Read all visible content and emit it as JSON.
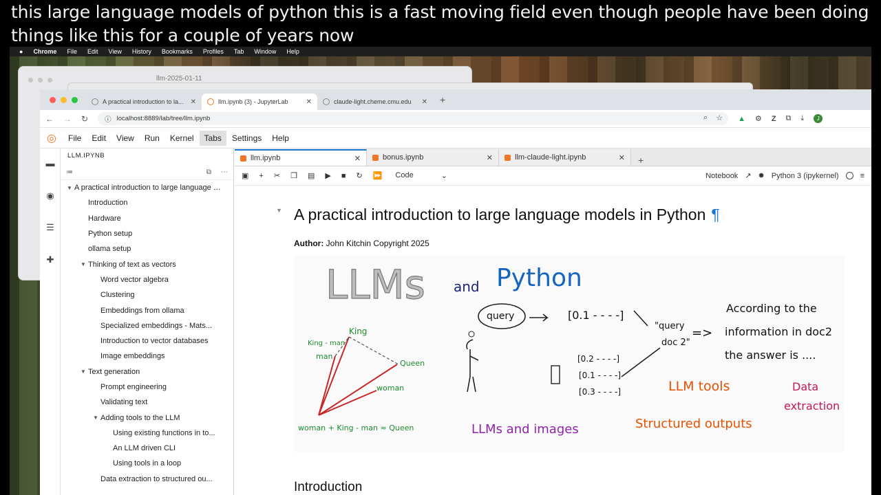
{
  "caption": {
    "line1": "this large language models of python this is a fast moving field even though people have been doing",
    "line2": "things like this for a couple of years now"
  },
  "macos_menu": {
    "apple": "",
    "items": [
      "Chrome",
      "File",
      "Edit",
      "View",
      "History",
      "Bookmarks",
      "Profiles",
      "Tab",
      "Window",
      "Help"
    ]
  },
  "background_window": {
    "title": "llm-2025-01-11"
  },
  "chrome": {
    "tabs": [
      {
        "label": "A practical introduction to la...",
        "active": false
      },
      {
        "label": "llm.ipynb (3) - JupyterLab",
        "active": true
      },
      {
        "label": "claude-light.cheme.cmu.edu",
        "active": false
      }
    ],
    "url": "localhost:8889/lab/tree/llm.ipynb",
    "profile_initial": "J"
  },
  "jupyter": {
    "menu": [
      "File",
      "Edit",
      "View",
      "Run",
      "Kernel",
      "Tabs",
      "Settings",
      "Help"
    ],
    "selected_menu": "Tabs",
    "toc_title": "LLM.IPYNB",
    "toc": [
      {
        "label": "A practical introduction to large language models in Python",
        "level": 1,
        "caret": "▼"
      },
      {
        "label": "Introduction",
        "level": 2,
        "caret": ""
      },
      {
        "label": "Hardware",
        "level": 2,
        "caret": ""
      },
      {
        "label": "Python setup",
        "level": 2,
        "caret": ""
      },
      {
        "label": "ollama setup",
        "level": 2,
        "caret": ""
      },
      {
        "label": "Thinking of text as vectors",
        "level": 2,
        "caret": "▼"
      },
      {
        "label": "Word vector algebra",
        "level": 3,
        "caret": ""
      },
      {
        "label": "Clustering",
        "level": 3,
        "caret": ""
      },
      {
        "label": "Embeddings from ollama",
        "level": 3,
        "caret": ""
      },
      {
        "label": "Specialized embeddings - Mats...",
        "level": 3,
        "caret": ""
      },
      {
        "label": "Introduction to vector databases",
        "level": 3,
        "caret": ""
      },
      {
        "label": "Image embeddings",
        "level": 3,
        "caret": ""
      },
      {
        "label": "Text generation",
        "level": 2,
        "caret": "▼"
      },
      {
        "label": "Prompt engineering",
        "level": 3,
        "caret": ""
      },
      {
        "label": "Validating text",
        "level": 3,
        "caret": ""
      },
      {
        "label": "Adding tools to the LLM",
        "level": 3,
        "caret": "▼"
      },
      {
        "label": "Using existing functions in to...",
        "level": 4,
        "caret": ""
      },
      {
        "label": "An LLM driven CLI",
        "level": 4,
        "caret": ""
      },
      {
        "label": "Using tools in a loop",
        "level": 4,
        "caret": ""
      },
      {
        "label": "Data extraction to structured ou...",
        "level": 3,
        "caret": ""
      }
    ],
    "doc_tabs": [
      {
        "label": "llm.ipynb",
        "active": true
      },
      {
        "label": "bonus.ipynb",
        "active": false
      },
      {
        "label": "llm-claude-light.ipynb",
        "active": false
      }
    ],
    "cell_type": "Code",
    "notebook_label": "Notebook",
    "kernel": "Python 3 (ipykernel)",
    "title": "A practical introduction to large language models in Python",
    "pilcrow": "¶",
    "author_label": "Author:",
    "author_value": " John Kitchin Copyright 2025",
    "next_heading": "Introduction"
  },
  "sketch": {
    "llms": "LLMs",
    "and": "and",
    "python": "Python",
    "query": "query",
    "vec1": "[0.1 - - - -]",
    "query_doc": "\"query",
    "doc2": "doc 2\"",
    "arrow": "=>",
    "answer1": "According to the",
    "answer2": "information in doc2",
    "answer3": "the answer is ....",
    "v2": "[0.2 - - - -]",
    "v3": "[0.1 - - - -]",
    "v4": "[0.3 - - - -]",
    "king_man": "King - man",
    "king": "King",
    "man": "man",
    "queen": "Queen",
    "woman": "woman",
    "equation": "woman + King - man ≈ Queen",
    "llm_tools": "LLM tools",
    "data_extraction1": "Data",
    "data_extraction2": "extraction",
    "llms_images": "LLMs and images",
    "structured": "Structured outputs"
  },
  "colors": {
    "jupyter_orange": "#f37626",
    "accent_blue": "#1976d2",
    "red_lines": "#c62828",
    "green_text": "#1b8a2e",
    "purple_text": "#8e24aa",
    "orange_text": "#e65100",
    "magenta_text": "#c2185b"
  }
}
